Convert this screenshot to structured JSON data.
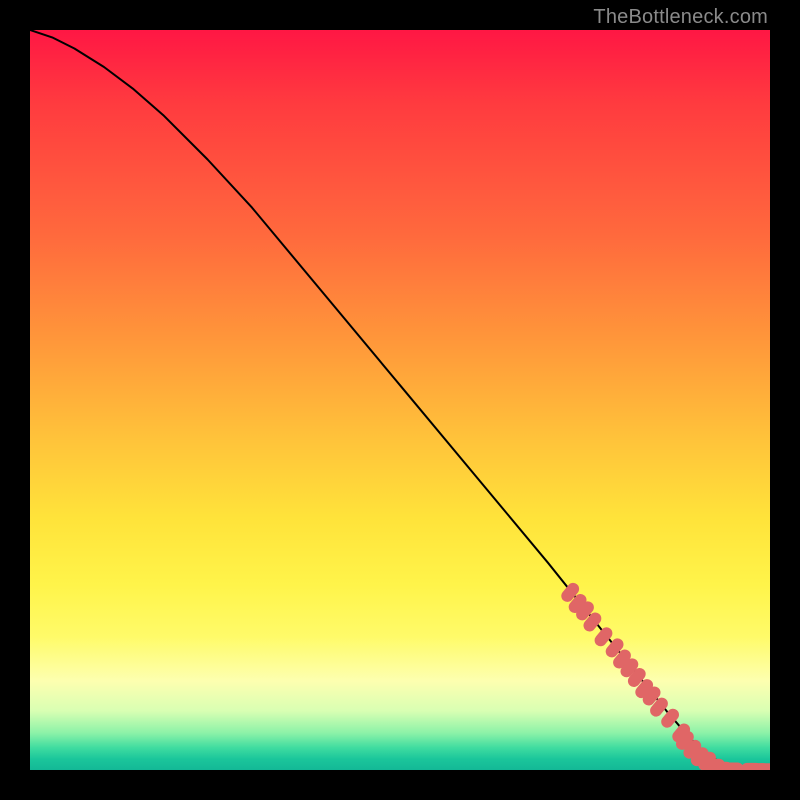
{
  "watermark": "TheBottleneck.com",
  "chart_data": {
    "type": "line",
    "title": "",
    "xlabel": "",
    "ylabel": "",
    "xlim": [
      0,
      100
    ],
    "ylim": [
      0,
      100
    ],
    "grid": false,
    "legend": false,
    "series": [
      {
        "name": "curve",
        "style": "line",
        "color": "#000000",
        "x": [
          0,
          3,
          6,
          10,
          14,
          18,
          24,
          30,
          40,
          50,
          60,
          70,
          78,
          82,
          86,
          89,
          91,
          93,
          95,
          97,
          100
        ],
        "y": [
          100,
          99,
          97.5,
          95,
          92,
          88.5,
          82.5,
          76,
          64,
          52,
          40,
          28,
          18,
          13,
          8,
          4.5,
          2.5,
          1.2,
          0.5,
          0.2,
          0
        ]
      },
      {
        "name": "bottleneck-points",
        "style": "scatter",
        "color": "#e06666",
        "x": [
          73,
          74,
          75,
          76,
          77.5,
          79,
          80,
          81,
          82,
          83,
          84,
          85,
          86.5,
          88,
          88.5,
          89.5,
          90.5,
          91.5,
          92.5,
          93.5,
          95,
          97.5,
          98.5,
          99.5
        ],
        "y": [
          24,
          22.5,
          21.5,
          20,
          18,
          16.5,
          15,
          13.8,
          12.5,
          11,
          10,
          8.5,
          7,
          5,
          4,
          2.8,
          1.8,
          1.2,
          0.7,
          0.3,
          0.2,
          0.15,
          0.12,
          0.1
        ]
      }
    ],
    "background_gradient_stops": [
      {
        "pos": 0.0,
        "color": "#ff1744"
      },
      {
        "pos": 0.28,
        "color": "#ff6a3d"
      },
      {
        "pos": 0.55,
        "color": "#ffc23a"
      },
      {
        "pos": 0.75,
        "color": "#fff44a"
      },
      {
        "pos": 0.92,
        "color": "#d9ffb3"
      },
      {
        "pos": 1.0,
        "color": "#13b896"
      }
    ]
  }
}
